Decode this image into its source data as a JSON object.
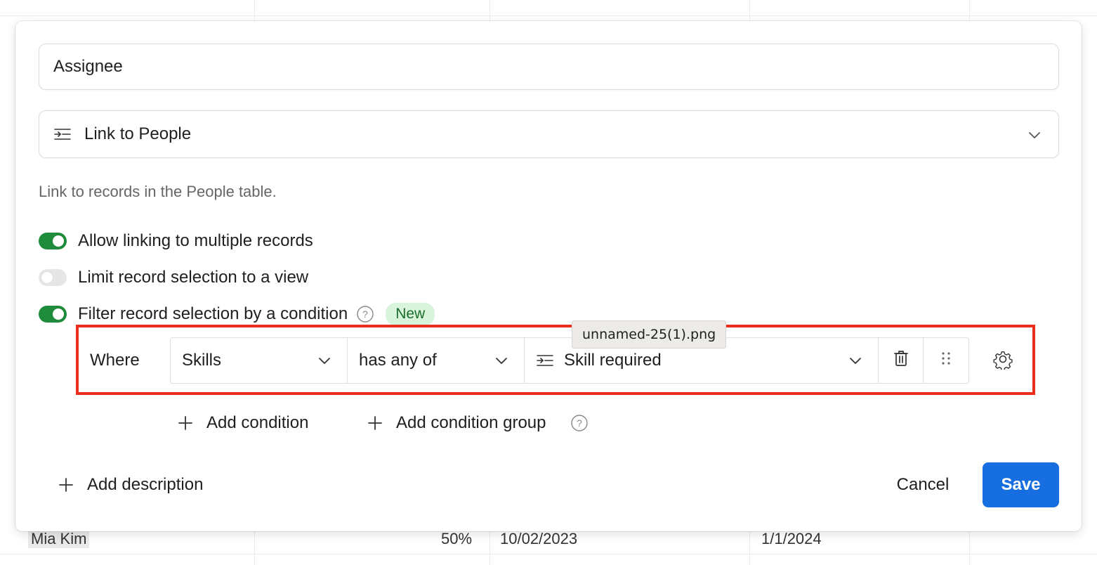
{
  "background_table": {
    "row": {
      "name": "Mia Kim",
      "percent": "50%",
      "date_1": "10/02/2023",
      "date_2": "1/1/2024"
    }
  },
  "dialog": {
    "field_name_value": "Assignee",
    "field_type": {
      "label": "Link to People",
      "icon": "link-records-icon"
    },
    "helper_text": "Link to records in the People table.",
    "options": [
      {
        "label": "Allow linking to multiple records",
        "enabled": true
      },
      {
        "label": "Limit record selection to a view",
        "enabled": false
      },
      {
        "label": "Filter record selection by a condition",
        "enabled": true,
        "badge": "New"
      }
    ],
    "condition": {
      "where_label": "Where",
      "field": "Skills",
      "operator": "has any of",
      "value": "Skill required",
      "value_icon": "link-records-icon"
    },
    "add_condition_label": "Add condition",
    "add_condition_group_label": "Add condition group",
    "add_description_label": "Add description",
    "cancel_label": "Cancel",
    "save_label": "Save"
  },
  "tooltip": {
    "text": "unnamed-25(1).png"
  },
  "colors": {
    "toggle_on": "#1e8c3a",
    "save_button": "#166ee1",
    "highlight_border": "#e8301c",
    "badge_bg": "#d8f5dc"
  }
}
